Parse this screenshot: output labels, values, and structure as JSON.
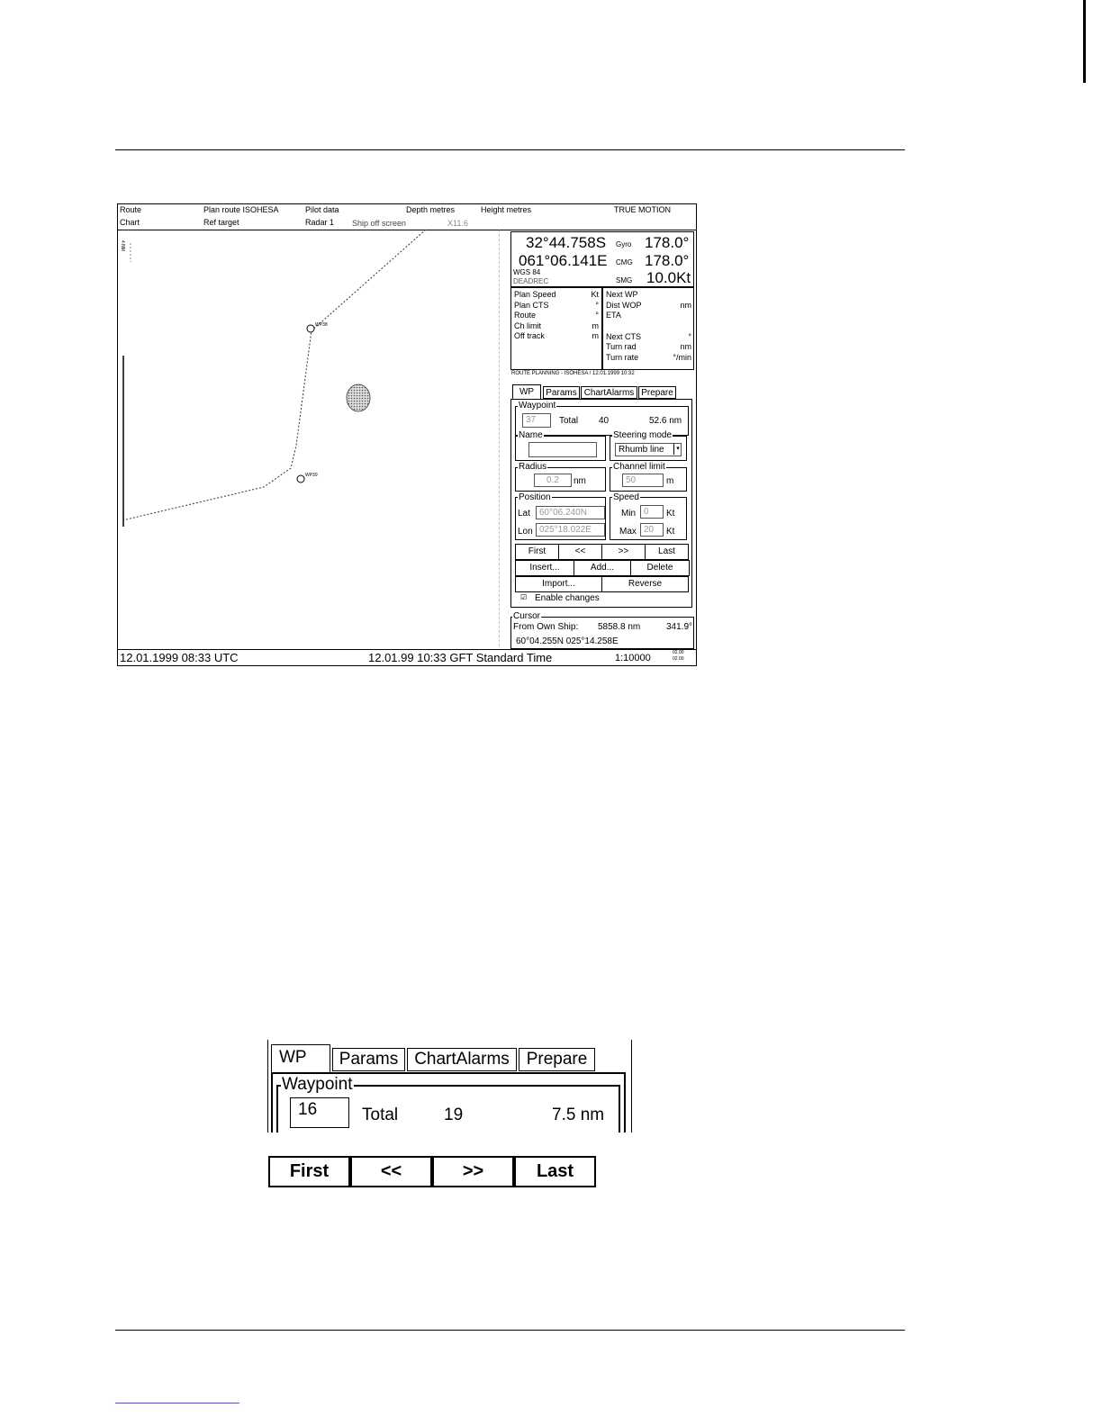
{
  "top_bar": {
    "row1": [
      "Route",
      "Plan route  ISOHESA",
      "Pilot data",
      "Depth metres",
      "Height metres",
      "TRUE MOTION"
    ],
    "row2": [
      "Chart",
      "Ref target",
      "Radar  1",
      "Ship off screen",
      "X11.6"
    ]
  },
  "map": {
    "scale_label": "4 NM",
    "wp_a_label": "WP38",
    "wp_b_label": "WP39"
  },
  "nav": {
    "lat": "32°44.758S",
    "lon": "061°06.141E",
    "datum": "WGS 84",
    "source": "DEADREC",
    "gyro_label": "Gyro",
    "gyro_value": "178.0°",
    "cmg_label": "CMG",
    "cmg_value": "178.0°",
    "smg_label": "SMG",
    "smg_value": "10.0Kt"
  },
  "plan": {
    "left": [
      {
        "label": "Plan Speed",
        "unit": "Kt"
      },
      {
        "label": "Plan CTS",
        "unit": "°"
      },
      {
        "label": "Route",
        "unit": "°"
      },
      {
        "label": "Ch limit",
        "unit": "m"
      },
      {
        "label": "Off track",
        "unit": "m"
      }
    ],
    "right": [
      {
        "label": "Next WP",
        "unit": ""
      },
      {
        "label": "Dist WOP",
        "unit": "nm"
      },
      {
        "label": "ETA",
        "unit": ""
      },
      {
        "label": "Next CTS",
        "unit": "°"
      },
      {
        "label": "Turn rad",
        "unit": "nm"
      },
      {
        "label": "Turn rate",
        "unit": "°/min"
      }
    ]
  },
  "route_planning": {
    "title": "ROUTE PLANNING - ISOHESA / 12.01.1999 10:32",
    "tabs": [
      "WP",
      "Params",
      "ChartAlarms",
      "Prepare"
    ],
    "waypoint_label": "Waypoint",
    "wp_number": "37",
    "total_label": "Total",
    "total_value": "40",
    "distance": "52.6 nm",
    "name_label": "Name",
    "name_value": "",
    "steering_label": "Steering mode",
    "steering_value": "Rhumb line",
    "radius_label": "Radius",
    "radius_value": "0.2",
    "radius_unit": "nm",
    "channel_label": "Channel limit",
    "channel_value": "50",
    "channel_unit": "m",
    "position_label": "Position",
    "lat_label": "Lat",
    "lat_value": "60°06.240N",
    "lon_label": "Lon",
    "lon_value": "025°18.022E",
    "speed_label": "Speed",
    "min_label": "Min",
    "min_value": "0",
    "max_label": "Max",
    "max_value": "20",
    "kt": "Kt",
    "nav_buttons": [
      "First",
      "<<",
      ">>",
      "Last"
    ],
    "edit_buttons": [
      "Insert...",
      "Add...",
      "Delete"
    ],
    "io_buttons": [
      "Import...",
      "Reverse"
    ],
    "enable_label": "Enable changes",
    "check_mark": "☑"
  },
  "cursor": {
    "label": "Cursor",
    "from_label": "From Own Ship:",
    "distance": "5858.8 nm",
    "bearing": "341.9°",
    "position": "60°04.255N  025°14.258E"
  },
  "status": {
    "utc": "12.01.1999 08:33 UTC",
    "local": "12.01.99 10:33 GFT Standard Time",
    "scale": "1:10000",
    "small1": "02.00",
    "small2": "02.00"
  },
  "detail": {
    "tabs": [
      "WP",
      "Params",
      "ChartAlarms",
      "Prepare"
    ],
    "waypoint_label": "Waypoint",
    "wp_number": "16",
    "total_label": "Total",
    "total_value": "19",
    "distance": "7.5 nm",
    "buttons": [
      "First",
      "<<",
      ">>",
      "Last"
    ]
  }
}
